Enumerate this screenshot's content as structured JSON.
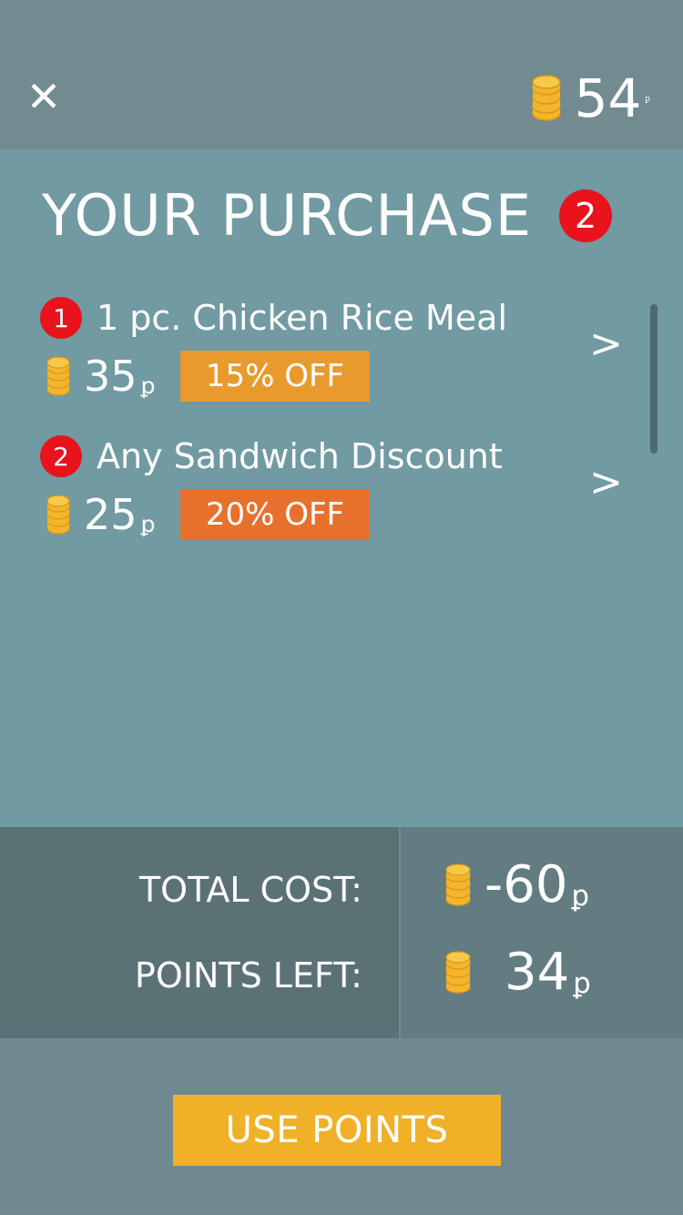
{
  "header": {
    "close_icon": "close-icon",
    "balance_value": "54",
    "currency_symbol": "ꝑ"
  },
  "purchase": {
    "title": "YOUR PURCHASE",
    "count": "2",
    "items": [
      {
        "number": "1",
        "name": "1 pc. Chicken Rice Meal",
        "price": "35",
        "discount": "15% OFF",
        "discount_color": "#e89a2d"
      },
      {
        "number": "2",
        "name": "Any Sandwich Discount",
        "price": "25",
        "discount": "20% OFF",
        "discount_color": "#e8702d"
      }
    ]
  },
  "summary": {
    "total_label": "TOTAL COST:",
    "total_value": "-60",
    "left_label": "POINTS LEFT:",
    "left_value": "34"
  },
  "action": {
    "use_points_label": "USE POINTS"
  },
  "colors": {
    "accent": "#f0b128",
    "badge": "#e8131c",
    "coin": "#f2b52b"
  }
}
